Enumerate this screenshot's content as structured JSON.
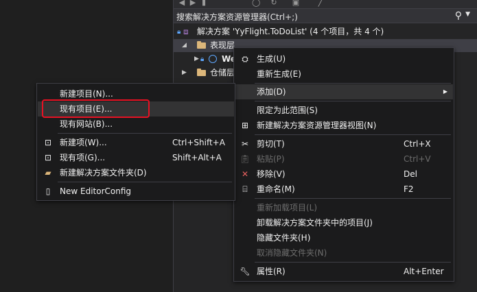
{
  "search": {
    "placeholder": "搜索解决方案资源管理器(Ctrl+;)"
  },
  "tree": {
    "solution": "解决方案 'YyFlight.ToDoList' (4 个项目，共 4 个)",
    "folder1": "表现层",
    "project1": "We",
    "folder2": "仓储层"
  },
  "menu_main": {
    "build": "生成(U)",
    "rebuild": "重新生成(E)",
    "add": "添加(D)",
    "scope": "限定为此范围(S)",
    "new_view": "新建解决方案资源管理器视图(N)",
    "cut": "剪切(T)",
    "cut_sc": "Ctrl+X",
    "paste": "粘贴(P)",
    "paste_sc": "Ctrl+V",
    "remove": "移除(V)",
    "remove_sc": "Del",
    "rename": "重命名(M)",
    "rename_sc": "F2",
    "reload": "重新加载项目(L)",
    "unload": "卸载解决方案文件夹中的项目(J)",
    "hide": "隐藏文件夹(H)",
    "unhide": "取消隐藏文件夹(N)",
    "props": "属性(R)",
    "props_sc": "Alt+Enter"
  },
  "menu_add": {
    "new_project": "新建项目(N)...",
    "existing_project": "现有项目(E)...",
    "existing_site": "现有网站(B)...",
    "new_item": "新建项(W)...",
    "new_item_sc": "Ctrl+Shift+A",
    "existing_item": "现有项(G)...",
    "existing_item_sc": "Shift+Alt+A",
    "new_sln_folder": "新建解决方案文件夹(D)",
    "editorconfig": "New EditorConfig"
  },
  "colors": {
    "accent": "#e81123",
    "lock": "#5fa8ff",
    "folder": "#dcb67a"
  }
}
